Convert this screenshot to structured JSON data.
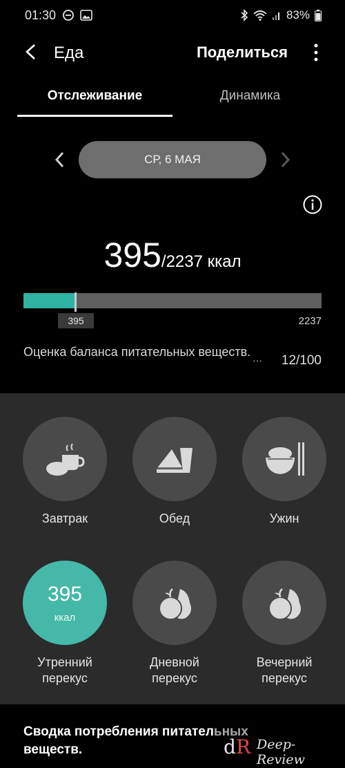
{
  "status_bar": {
    "time": "01:30",
    "battery": "83%"
  },
  "header": {
    "title": "Еда",
    "share_label": "Поделиться"
  },
  "tabs": [
    {
      "label": "Отслеживание",
      "active": true
    },
    {
      "label": "Динамика",
      "active": false
    }
  ],
  "date_selector": {
    "date": "СР, 6 МАЯ"
  },
  "calories": {
    "consumed": "395",
    "target_text": "/2237 ккал"
  },
  "progress": {
    "value": 395,
    "max": 2237,
    "value_label": "395",
    "max_label": "2237",
    "color": "#2fb3a3"
  },
  "nutrient_balance": {
    "label": "Оценка баланса питательных веществ.",
    "ellipsis": "···",
    "score": "12/100"
  },
  "meals": [
    {
      "label": "Завтрак",
      "icon": "coffee-bread-icon"
    },
    {
      "label": "Обед",
      "icon": "sandwich-drink-icon"
    },
    {
      "label": "Ужин",
      "icon": "rice-bowl-chopsticks-icon"
    },
    {
      "label": "Утренний\nперекус",
      "icon": "fruit-icon",
      "value": "395",
      "unit": "ккал",
      "active": true
    },
    {
      "label": "Дневной\nперекус",
      "icon": "fruit-icon"
    },
    {
      "label": "Вечерний\nперекус",
      "icon": "fruit-icon"
    }
  ],
  "summary": {
    "title": "Сводка потребления питательных веществ."
  },
  "watermark": {
    "logo": "dR",
    "text": "Deep-Review"
  },
  "colors": {
    "accent": "#2fb3a3",
    "active_circle": "#45b8a9",
    "panel": "#2b2b2b",
    "circle": "#4a4a4a"
  }
}
